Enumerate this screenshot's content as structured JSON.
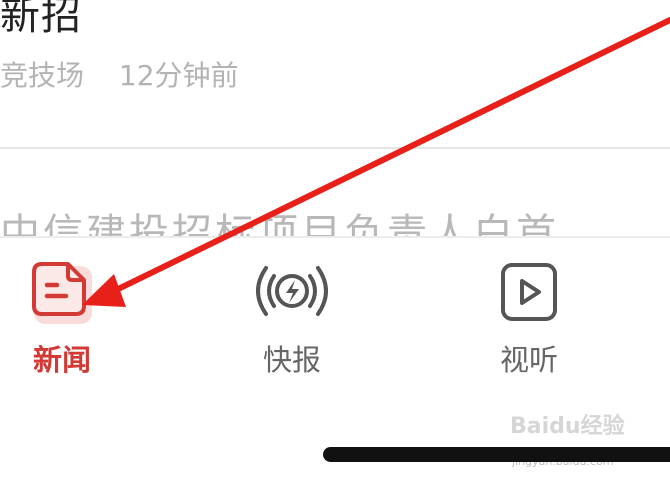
{
  "article": {
    "title": "新招",
    "source": "竞技场",
    "time": "12分钟前"
  },
  "next_article": {
    "title_partial": "中信建投招标项目负责人白首"
  },
  "tabbar": {
    "news": {
      "label": "新闻",
      "icon": "news-doc-icon",
      "active": true
    },
    "flash": {
      "label": "快报",
      "icon": "lightning-broadcast-icon"
    },
    "av": {
      "label": "视听",
      "icon": "play-icon"
    }
  },
  "colors": {
    "accent": "#d33a35",
    "annotation_arrow": "#e8201a"
  },
  "watermark": {
    "text": "Baidu经验",
    "url": "jingyan.baidu.com"
  }
}
